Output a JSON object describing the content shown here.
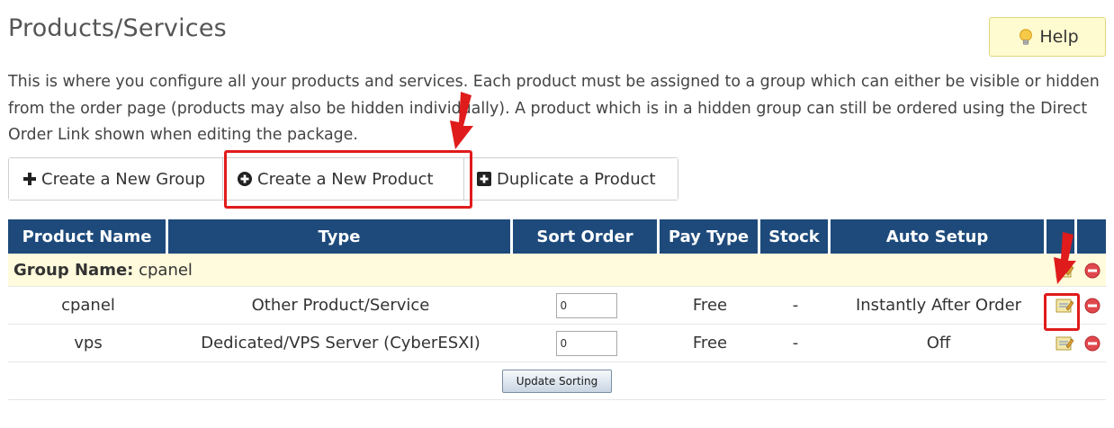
{
  "header": {
    "title": "Products/Services",
    "help_label": "Help"
  },
  "description": "This is where you configure all your products and services. Each product must be assigned to a group which can either be visible or hidden from the order page (products may also be hidden individually). A product which is in a hidden group can still be ordered using the Direct Order Link shown when editing the package.",
  "actions": {
    "create_group": "Create a New Group",
    "create_product": "Create a New Product",
    "duplicate_product": "Duplicate a Product"
  },
  "table": {
    "columns": [
      "Product Name",
      "Type",
      "Sort Order",
      "Pay Type",
      "Stock",
      "Auto Setup",
      "",
      ""
    ],
    "group": {
      "label": "Group Name:",
      "name": "cpanel"
    },
    "rows": [
      {
        "name": "cpanel",
        "type": "Other Product/Service",
        "sort": "0",
        "pay_type": "Free",
        "stock": "-",
        "auto_setup": "Instantly After Order"
      },
      {
        "name": "vps",
        "type": "Dedicated/VPS Server (CyberESXI)",
        "sort": "0",
        "pay_type": "Free",
        "stock": "-",
        "auto_setup": "Off"
      }
    ],
    "update_label": "Update Sorting"
  },
  "colors": {
    "header_bg": "#1e4a7b",
    "group_bg": "#fffbdc",
    "help_bg": "#fffbd0",
    "highlight": "#e01b1b",
    "delete": "#e0484d"
  },
  "icons": [
    "lightbulb-icon",
    "plus-icon",
    "plus-circle-icon",
    "plus-square-icon",
    "edit-icon",
    "delete-icon",
    "red-arrow-annotation"
  ]
}
